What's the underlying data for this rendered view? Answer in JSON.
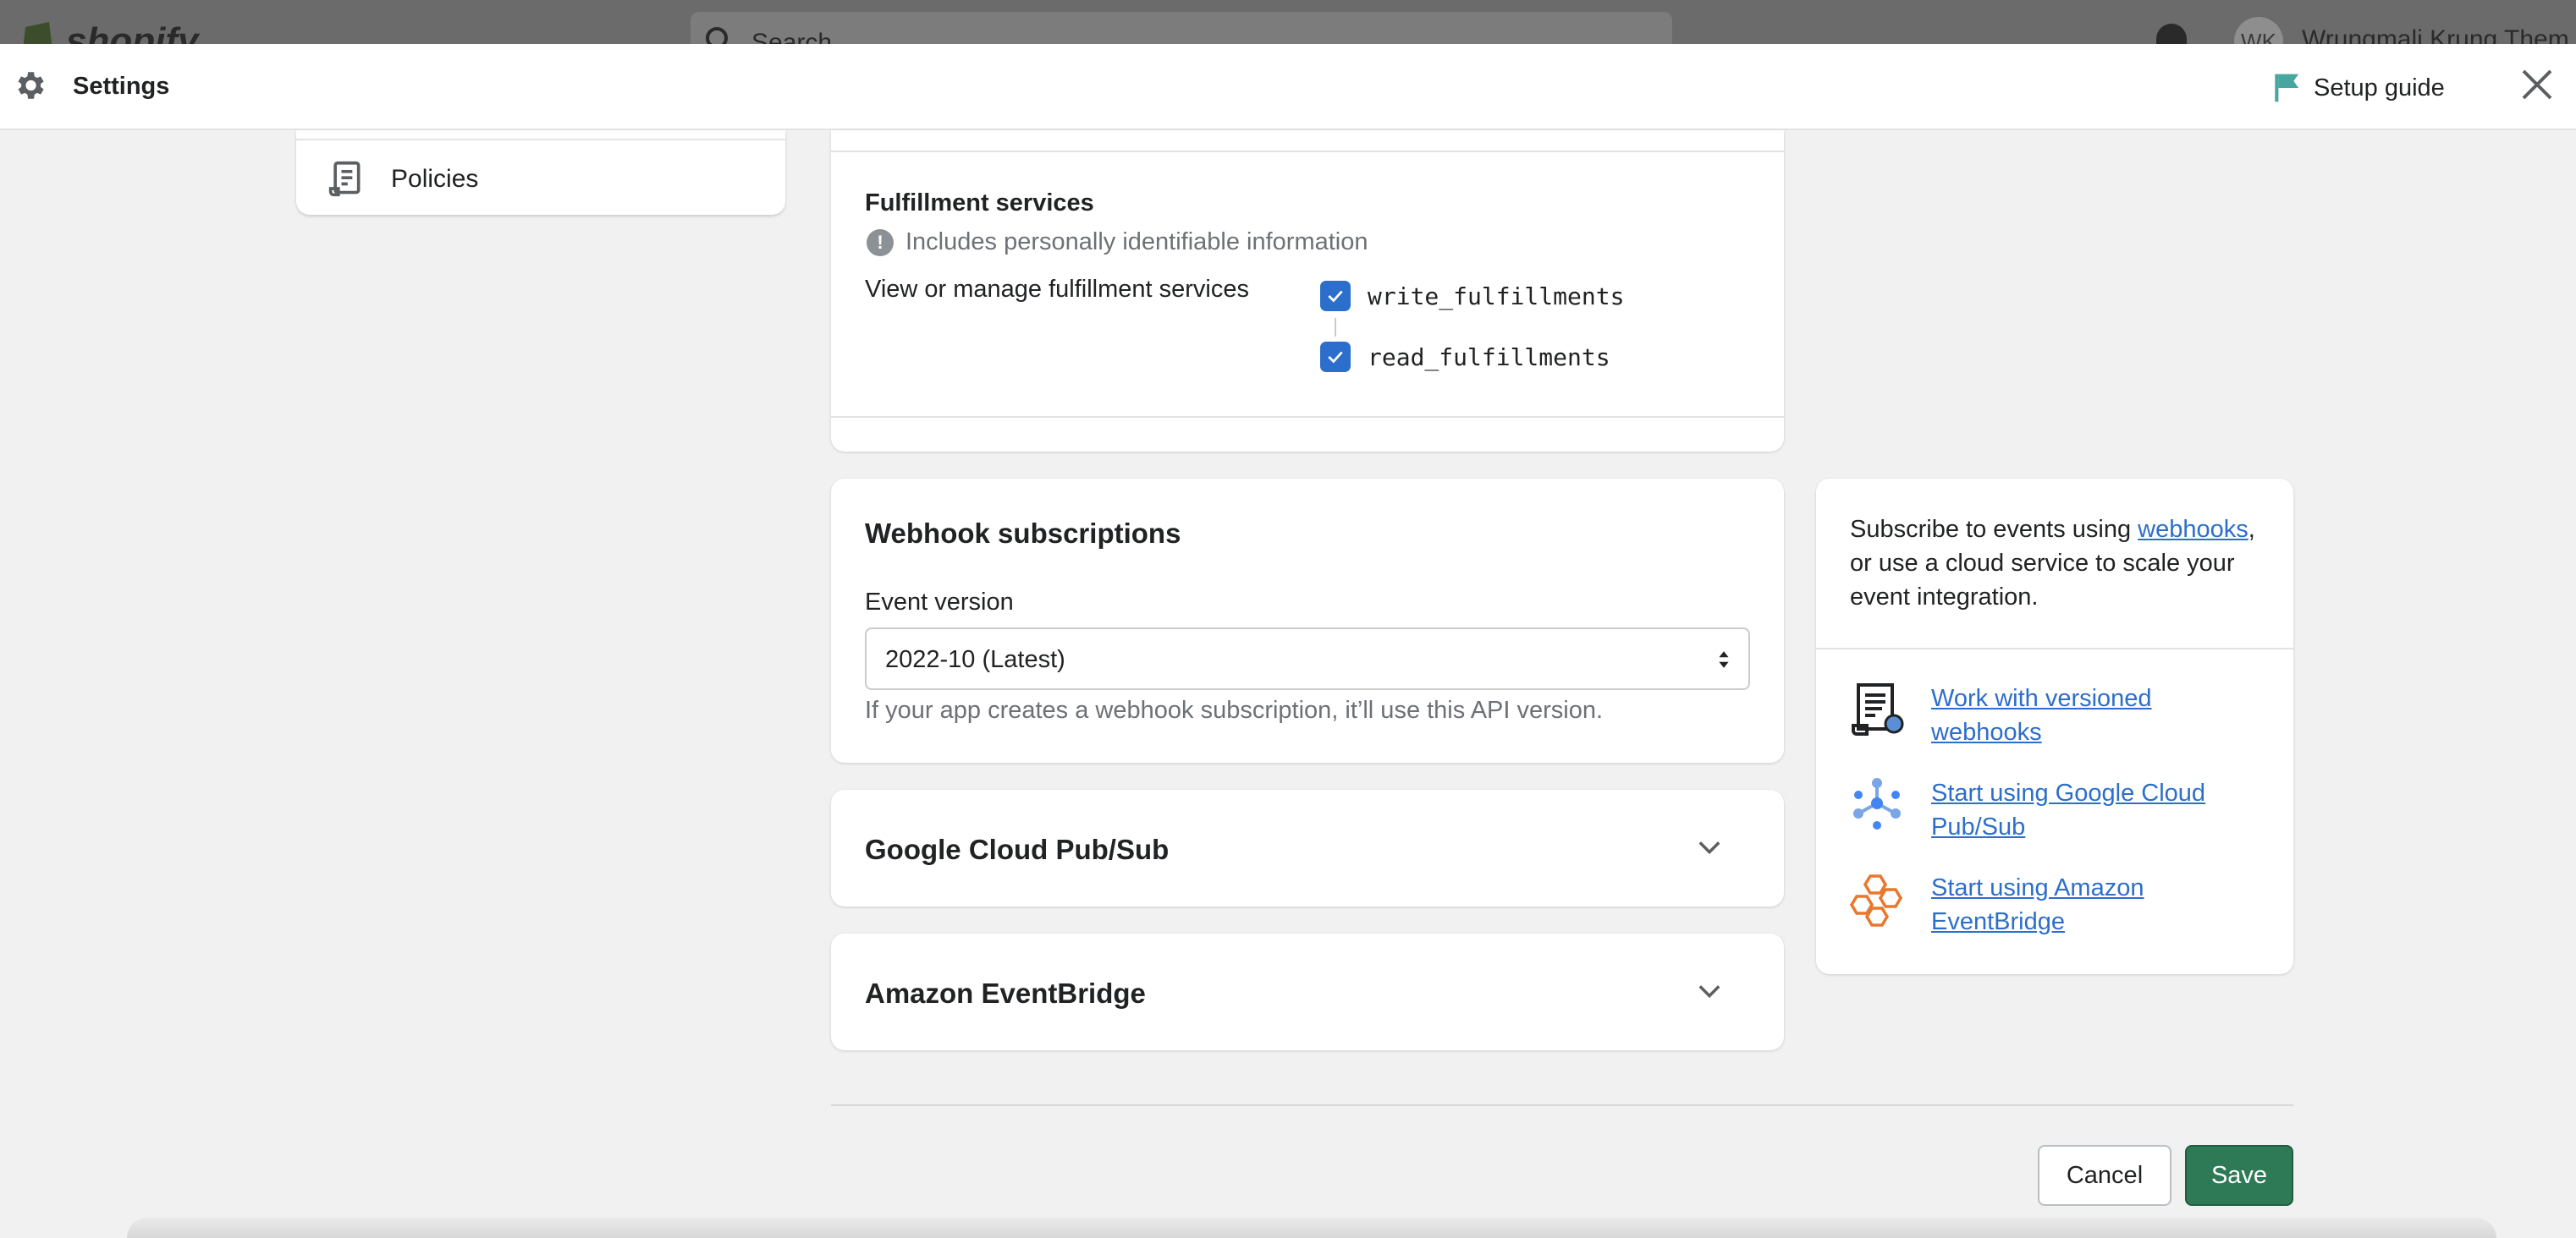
{
  "topbar": {
    "logo_text": "shopify",
    "search_placeholder": "Search",
    "avatar_initials": "WK",
    "user_name": "Wrungmali Krung Them"
  },
  "header": {
    "title": "Settings",
    "setup_guide_label": "Setup guide"
  },
  "sidebar": {
    "items": [
      {
        "label": "Policies",
        "icon": "policies-icon"
      }
    ]
  },
  "fulfillment": {
    "title": "Fulfillment services",
    "pii_notice": "Includes personally identifiable information",
    "description": "View or manage fulfillment services",
    "scopes": [
      {
        "name": "write_fulfillments",
        "checked": true
      },
      {
        "name": "read_fulfillments",
        "checked": true
      }
    ]
  },
  "webhooks": {
    "title": "Webhook subscriptions",
    "event_version_label": "Event version",
    "event_version_value": "2022-10 (Latest)",
    "help_text": "If your app creates a webhook subscription, it’ll use this API version."
  },
  "google_cloud": {
    "title": "Google Cloud Pub/Sub"
  },
  "eventbridge": {
    "title": "Amazon EventBridge"
  },
  "info": {
    "intro_before": "Subscribe to events using ",
    "intro_link": "webhooks",
    "intro_after": ", or use a cloud service to scale your event integration.",
    "resources": [
      {
        "label": "Work with versioned webhooks",
        "icon": "versioned-webhooks-icon"
      },
      {
        "label": "Start using Google Cloud Pub/Sub",
        "icon": "google-cloud-pubsub-icon"
      },
      {
        "label": "Start using Amazon EventBridge",
        "icon": "amazon-eventbridge-icon"
      }
    ]
  },
  "footer": {
    "cancel_label": "Cancel",
    "save_label": "Save"
  },
  "colors": {
    "accent_blue": "#2c6ecb",
    "save_green": "#2e7a56",
    "flag_teal": "#47a7a0",
    "eventbridge_orange": "#e8782e"
  }
}
